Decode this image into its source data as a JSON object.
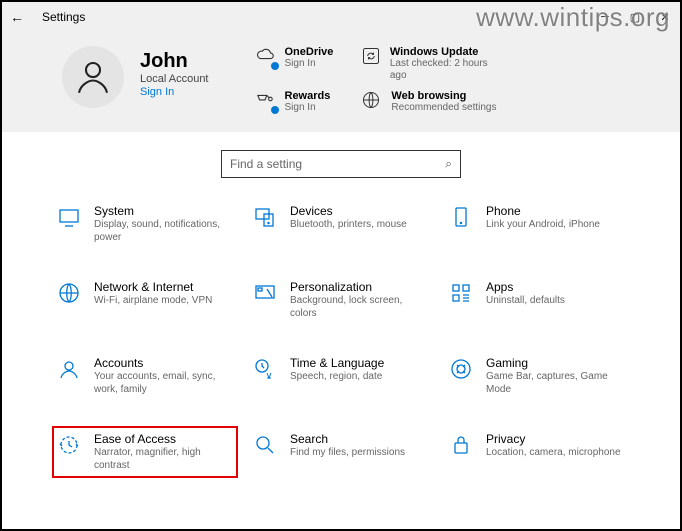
{
  "window": {
    "title": "Settings"
  },
  "watermark": "www.wintips.org",
  "user": {
    "name": "John",
    "account_type": "Local Account",
    "signin_label": "Sign In"
  },
  "header_tiles": [
    {
      "icon": "cloud-icon",
      "title": "OneDrive",
      "sub": "Sign In",
      "dot": true
    },
    {
      "icon": "refresh-icon",
      "title": "Windows Update",
      "sub": "Last checked: 2 hours ago",
      "dot": false
    },
    {
      "icon": "rewards-icon",
      "title": "Rewards",
      "sub": "Sign In",
      "dot": true
    },
    {
      "icon": "globe-icon",
      "title": "Web browsing",
      "sub": "Recommended settings",
      "dot": false
    }
  ],
  "search": {
    "placeholder": "Find a setting"
  },
  "categories": [
    {
      "icon": "system-icon",
      "title": "System",
      "sub": "Display, sound, notifications, power",
      "highlight": false
    },
    {
      "icon": "devices-icon",
      "title": "Devices",
      "sub": "Bluetooth, printers, mouse",
      "highlight": false
    },
    {
      "icon": "phone-icon",
      "title": "Phone",
      "sub": "Link your Android, iPhone",
      "highlight": false
    },
    {
      "icon": "network-icon",
      "title": "Network & Internet",
      "sub": "Wi-Fi, airplane mode, VPN",
      "highlight": false
    },
    {
      "icon": "personalize-icon",
      "title": "Personalization",
      "sub": "Background, lock screen, colors",
      "highlight": false
    },
    {
      "icon": "apps-icon",
      "title": "Apps",
      "sub": "Uninstall, defaults",
      "highlight": false
    },
    {
      "icon": "accounts-icon",
      "title": "Accounts",
      "sub": "Your accounts, email, sync, work, family",
      "highlight": false
    },
    {
      "icon": "time-icon",
      "title": "Time & Language",
      "sub": "Speech, region, date",
      "highlight": false
    },
    {
      "icon": "gaming-icon",
      "title": "Gaming",
      "sub": "Game Bar, captures, Game Mode",
      "highlight": false
    },
    {
      "icon": "ease-icon",
      "title": "Ease of Access",
      "sub": "Narrator, magnifier, high contrast",
      "highlight": true
    },
    {
      "icon": "search-cat-icon",
      "title": "Search",
      "sub": "Find my files, permissions",
      "highlight": false
    },
    {
      "icon": "privacy-icon",
      "title": "Privacy",
      "sub": "Location, camera, microphone",
      "highlight": false
    }
  ]
}
